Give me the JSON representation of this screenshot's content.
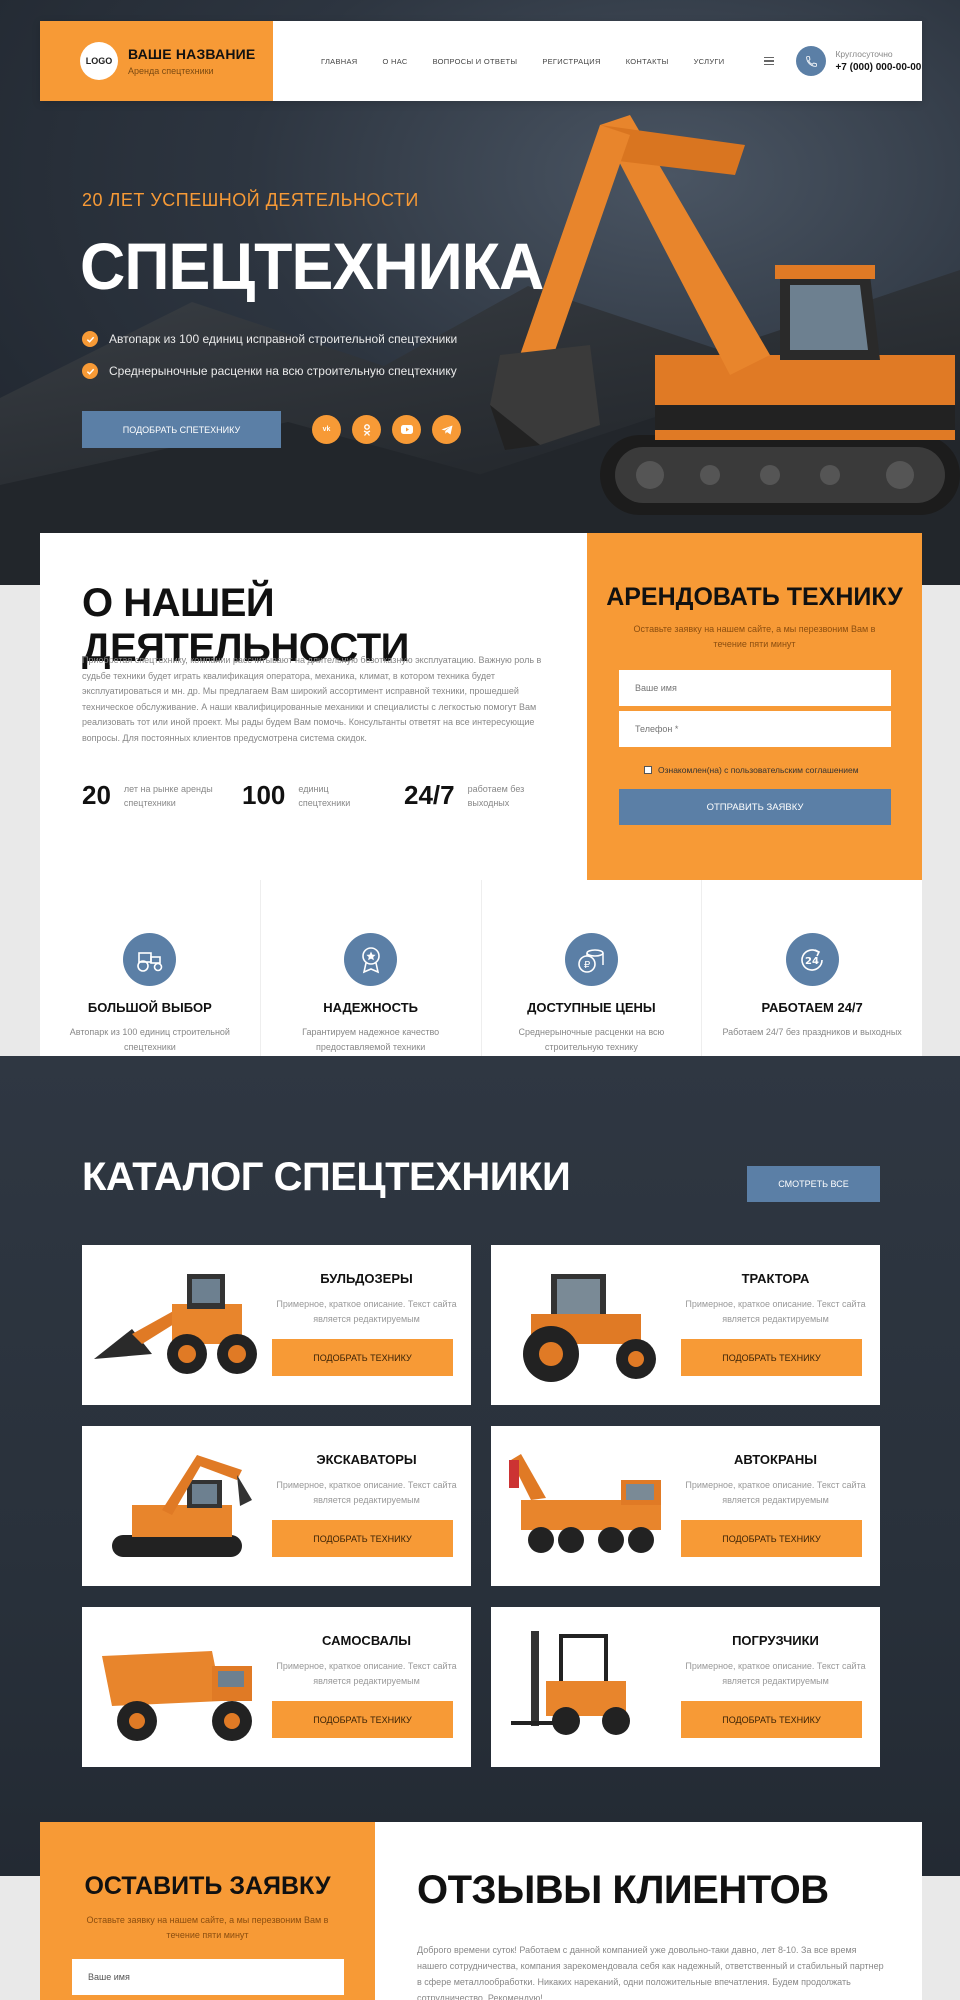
{
  "colors": {
    "accent": "#f79a36",
    "blue": "#5b7fa6",
    "dark": "#2d3540"
  },
  "header": {
    "logo": "LOGO",
    "brand_name": "ВАШЕ НАЗВАНИЕ",
    "brand_sub": "Аренда спецтехники",
    "nav": [
      "ГЛАВНАЯ",
      "О НАС",
      "ВОПРОСЫ И ОТВЕТЫ",
      "РЕГИСТРАЦИЯ",
      "КОНТАКТЫ",
      "УСЛУГИ"
    ],
    "phone_label": "Круглосуточно",
    "phone": "+7 (000) 000-00-00"
  },
  "hero": {
    "years": "20 ЛЕТ УСПЕШНОЙ ДЕЯТЕЛЬНОСТИ",
    "title": "СПЕЦТЕХНИКА",
    "bullets": [
      "Автопарк из 100 единиц исправной строительной спецтехники",
      "Среднерыночные расценки на всю строительную спецтехнику"
    ],
    "cta": "ПОДОБРАТЬ СПЕТЕХНИКУ",
    "socials": [
      "vk-icon",
      "ok-icon",
      "youtube-icon",
      "telegram-icon"
    ]
  },
  "about": {
    "title": "О НАШЕЙ ДЕЯТЕЛЬНОСТИ",
    "text": "Приобретая спецтехнику, компании рассчитывают на длительную безотказную эксплуатацию. Важную роль в судьбе техники будет играть квалификация оператора, механика, климат, в котором техника будет эксплуатироваться и мн. др. Мы предлагаем Вам широкий ассортимент исправной техники, прошедшей техническое обслуживание. А наши квалифицированные механики и специалисты с легкостью помогут Вам реализовать тот или иной проект. Мы рады будем Вам помочь. Консультанты ответят на все интересующие вопросы. Для постоянных клиентов предусмотрена система скидок.",
    "stats": [
      {
        "num": "20",
        "label1": "лет на рынке аренды",
        "label2": "спецтехники"
      },
      {
        "num": "100",
        "label1": "единиц",
        "label2": "спецтехники"
      },
      {
        "num": "24/7",
        "label1": "работаем без",
        "label2": "выходных"
      }
    ]
  },
  "rent": {
    "title": "АРЕНДОВАТЬ ТЕХНИКУ",
    "sub": "Оставьте заявку на нашем сайте, а мы перезвоним Вам в течение пяти минут",
    "name_placeholder": "Ваше имя",
    "phone_placeholder": "Телефон *",
    "agree": "Ознакомлен(на) с пользовательским соглашением",
    "submit": "ОТПРАВИТЬ ЗАЯВКУ"
  },
  "features": [
    {
      "icon": "tractor-icon",
      "title": "БОЛЬШОЙ ВЫБОР",
      "desc": "Автопарк из 100 единиц строительной спецтехники"
    },
    {
      "icon": "award-icon",
      "title": "НАДЕЖНОСТЬ",
      "desc": "Гарантируем надежное качество предоставляемой техники"
    },
    {
      "icon": "coins-icon",
      "title": "ДОСТУПНЫЕ ЦЕНЫ",
      "desc": "Среднерыночные расценки на всю строительную технику"
    },
    {
      "icon": "24-hours-icon",
      "title": "РАБОТАЕМ 24/7",
      "desc": "Работаем 24/7 без праздников и выходных"
    }
  ],
  "catalog": {
    "title": "КАТАЛОГ СПЕЦТЕХНИКИ",
    "see_all": "СМОТРЕТЬ ВСЕ",
    "desc": "Примерное, краткое описание. Текст сайта является редактируемым",
    "button": "ПОДОБРАТЬ ТЕХНИКУ",
    "items": [
      {
        "title": "БУЛЬДОЗЕРЫ",
        "img": "loader-image"
      },
      {
        "title": "ТРАКТОРА",
        "img": "tractor-image"
      },
      {
        "title": "ЭКСКАВАТОРЫ",
        "img": "excavator-image"
      },
      {
        "title": "АВТОКРАНЫ",
        "img": "crane-truck-image"
      },
      {
        "title": "САМОСВАЛЫ",
        "img": "dump-truck-image"
      },
      {
        "title": "ПОГРУЗЧИКИ",
        "img": "forklift-image"
      }
    ]
  },
  "order": {
    "title": "ОСТАВИТЬ ЗАЯВКУ",
    "sub": "Оставьте заявку на нашем сайте, а мы перезвоним Вам в течение пяти минут",
    "name_placeholder": "Ваше имя"
  },
  "reviews": {
    "title": "ОТЗЫВЫ КЛИЕНТОВ",
    "text": "Доброго времени суток! Работаем с данной компанией уже довольно-таки давно, лет 8-10. За все время нашего сотрудничества, компания зарекомендовала себя как надежный, ответственный и стабильный партнер в сфере металлообработки. Никаких нареканий, одни положительные впечатления. Будем продолжать сотрудничество. Рекомендую!"
  }
}
